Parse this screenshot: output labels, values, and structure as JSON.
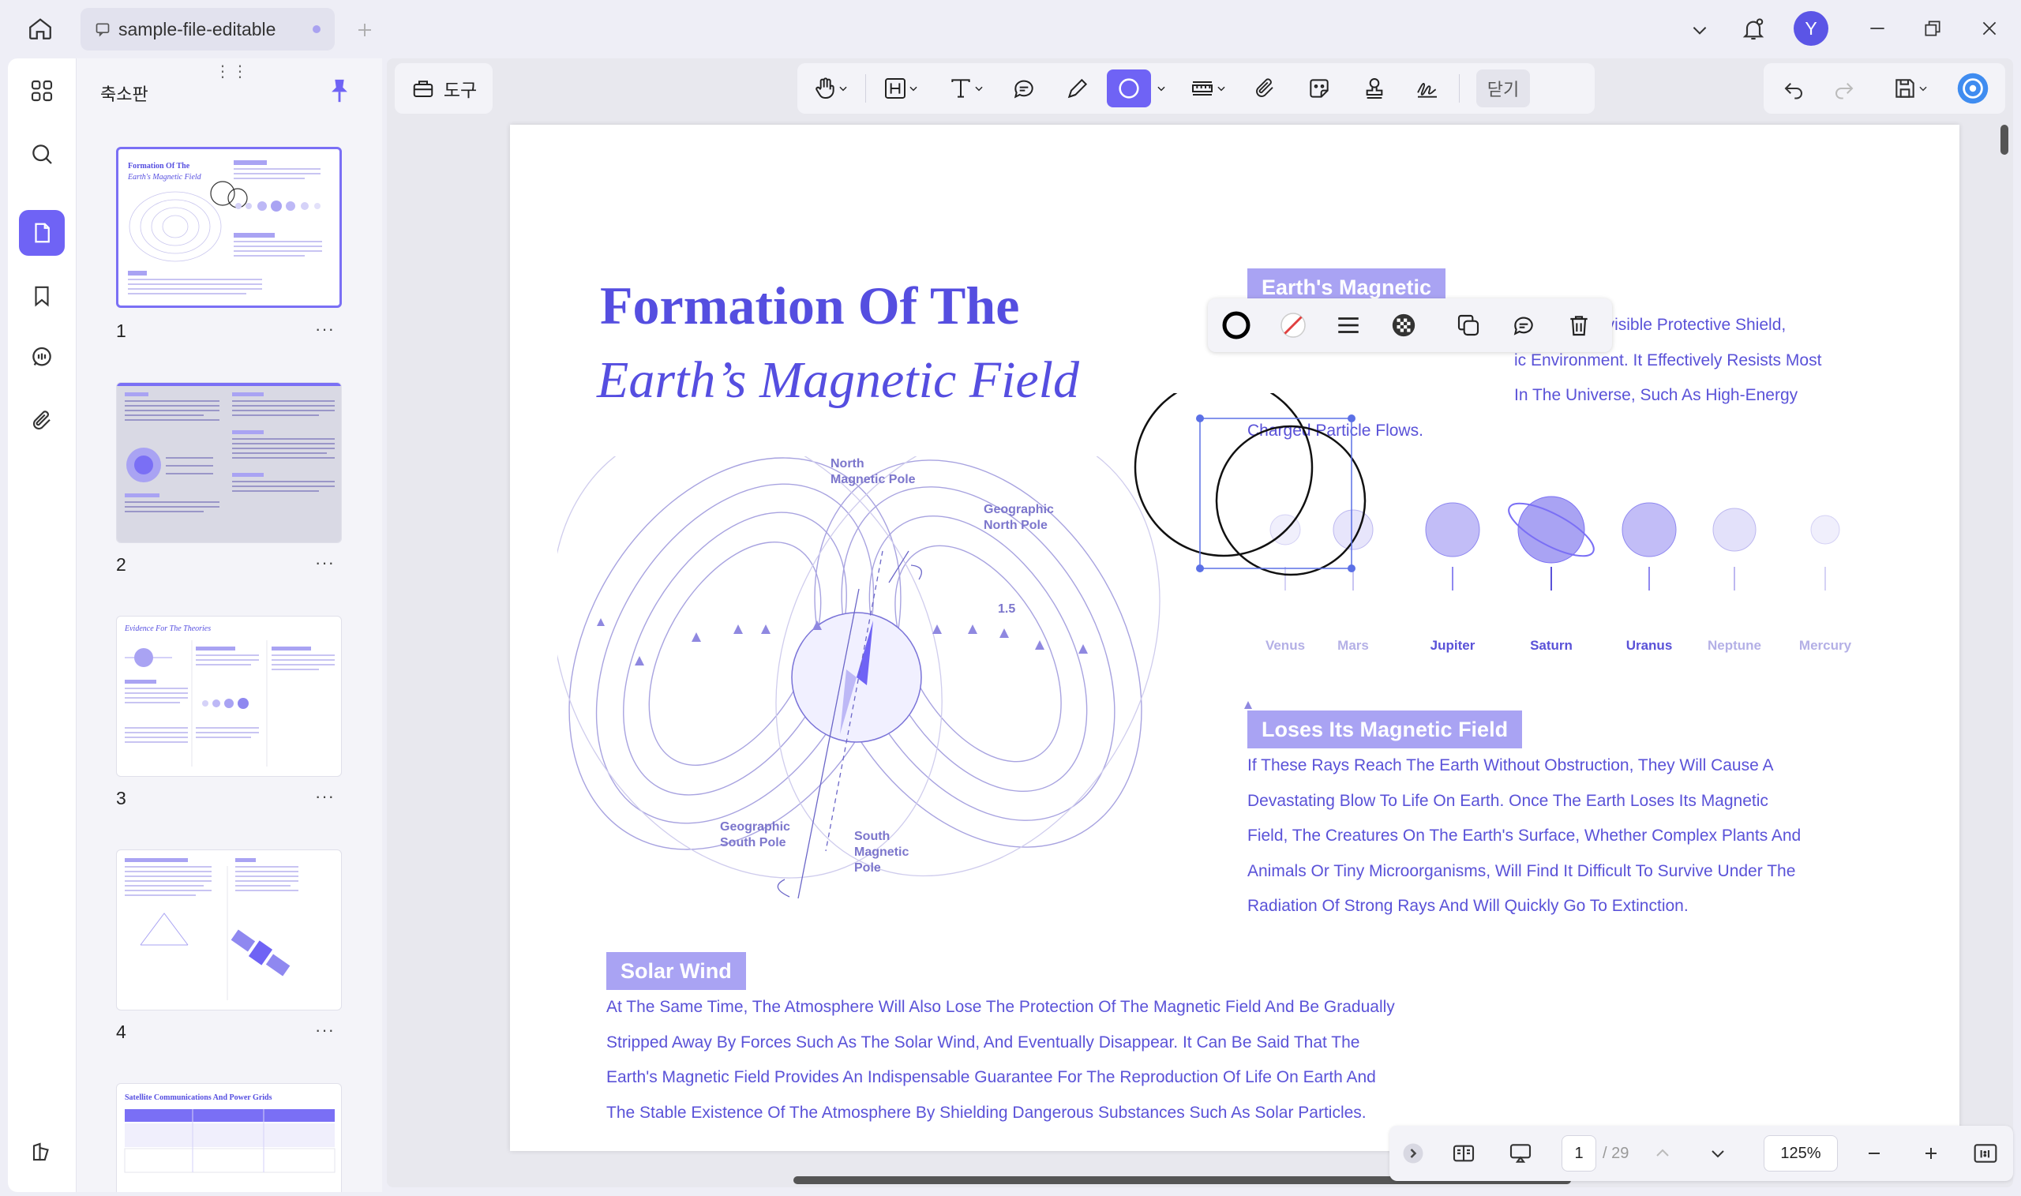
{
  "tab": {
    "title": "sample-file-editable"
  },
  "user": {
    "initial": "Y"
  },
  "sidebar": {
    "panel_title": "축소판",
    "pages": [
      {
        "number": "1",
        "more": "···"
      },
      {
        "number": "2",
        "more": "···"
      },
      {
        "number": "3",
        "more": "···"
      },
      {
        "number": "4",
        "more": "···"
      }
    ],
    "thumb_texts": {
      "t1_title": "Formation Of The",
      "t1_sub": "Earth's Magnetic Field",
      "t3_title": "Evidence For The Theories",
      "t5_title": "Satellite Communications And Power Grids"
    }
  },
  "toolbar": {
    "tools_label": "도구",
    "close_label": "닫기"
  },
  "document": {
    "title_line1": "Formation Of The",
    "title_line2": "Earth’s Magnetic Field",
    "sections": {
      "earth": {
        "heading": "Earth's Magnetic",
        "lines": [
          "The Earth's Magnetic Field Is Like A Huge And Invisible Protective Shield,",
          "ic Environment. It Effectively Resists Most",
          "In The Universe, Such As High-Energy",
          "Charged Particle Flows."
        ]
      },
      "loses": {
        "heading": "Loses Its Magnetic Field",
        "lines": [
          "If These Rays Reach The Earth Without Obstruction, They Will Cause A",
          "Devastating Blow To Life On Earth. Once The Earth Loses Its Magnetic",
          "Field, The Creatures On The Earth's Surface, Whether Complex Plants And",
          "Animals Or Tiny Microorganisms, Will Find It Difficult To Survive Under The",
          "Radiation Of Strong Rays And Will Quickly Go To Extinction."
        ]
      },
      "solar": {
        "heading": "Solar Wind",
        "lines": [
          "At The Same Time, The Atmosphere Will Also Lose The Protection Of The Magnetic Field And Be Gradually",
          "Stripped Away By Forces Such As The Solar Wind, And Eventually Disappear. It Can Be Said That The",
          "Earth's Magnetic Field Provides An Indispensable Guarantee For The Reproduction Of Life On Earth And",
          "The Stable Existence Of The Atmosphere By Shielding Dangerous Substances Such As Solar Particles."
        ]
      }
    },
    "planets": [
      "Venus",
      "Mars",
      "Jupiter",
      "Saturn",
      "Uranus",
      "Neptune",
      "Mercury"
    ],
    "diagram": {
      "north_magnetic": [
        "North",
        "Magnetic Pole"
      ],
      "geo_north": [
        "Geographic",
        "North Pole"
      ],
      "geo_south": [
        "Geographic",
        "South Pole"
      ],
      "south_magnetic": [
        "South",
        "Magnetic",
        "Pole"
      ],
      "angle": "1.5"
    }
  },
  "navigation": {
    "current_page": "1",
    "total_pages": "/ 29",
    "zoom": "125%"
  },
  "colors": {
    "accent": "#6f63f5",
    "heading_bg": "#a9a3f3",
    "text": "#5a52d8",
    "title": "#554ee0"
  }
}
